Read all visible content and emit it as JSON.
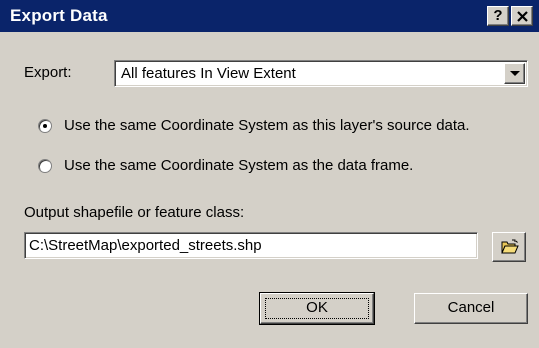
{
  "window": {
    "title": "Export Data",
    "help_label": "?"
  },
  "export": {
    "label": "Export:",
    "selected_value": "All features In View Extent"
  },
  "coordinate_options": [
    {
      "label": "Use the same Coordinate System as this layer's source data.",
      "selected": true
    },
    {
      "label": "Use the same Coordinate System as the data frame.",
      "selected": false
    }
  ],
  "output": {
    "label": "Output shapefile or feature class:",
    "value": "C:\\StreetMap\\exported_streets.shp"
  },
  "buttons": {
    "ok": "OK",
    "cancel": "Cancel"
  },
  "icons": {
    "close": "close-icon",
    "dropdown": "chevron-down-icon",
    "browse": "open-folder-icon"
  },
  "colors": {
    "title_bar": "#0a246a",
    "face": "#d4d0c8"
  }
}
